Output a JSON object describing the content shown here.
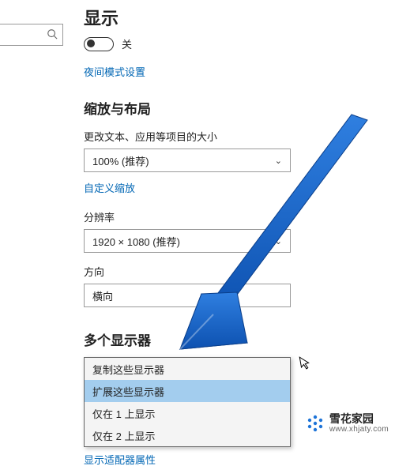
{
  "search": {
    "placeholder": ""
  },
  "display": {
    "title": "显示",
    "toggle_state": "关",
    "night_mode_link": "夜间模式设置"
  },
  "scale": {
    "heading": "缩放与布局",
    "text_size_label": "更改文本、应用等项目的大小",
    "text_size_value": "100% (推荐)",
    "custom_scale_link": "自定义缩放",
    "resolution_label": "分辨率",
    "resolution_value": "1920 × 1080 (推荐)",
    "orientation_label": "方向",
    "orientation_value": "横向"
  },
  "multi": {
    "heading": "多个显示器",
    "options": [
      "复制这些显示器",
      "扩展这些显示器",
      "仅在 1 上显示",
      "仅在 2 上显示"
    ],
    "selected_index": 1,
    "adapter_link": "显示适配器属性"
  },
  "watermark": {
    "brand": "雪花家园",
    "url": "www.xhjaty.com"
  }
}
